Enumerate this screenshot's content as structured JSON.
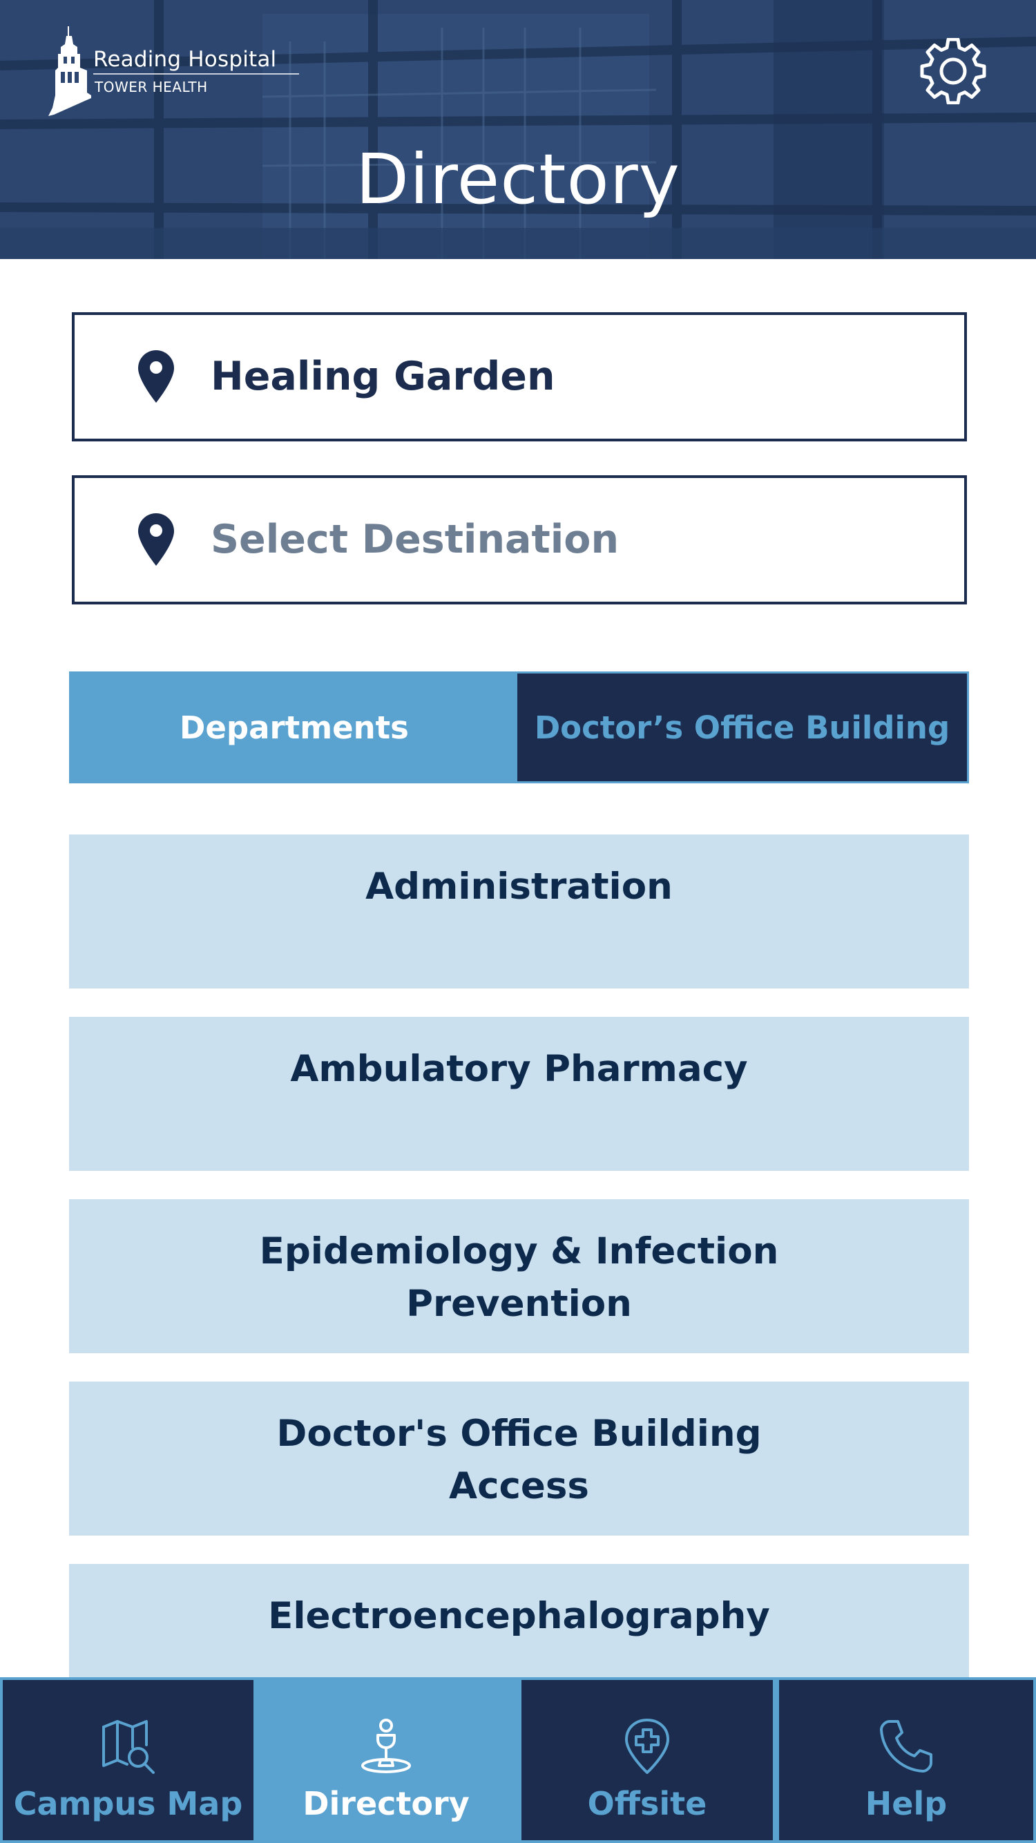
{
  "header": {
    "logo": {
      "name": "Reading Hospital",
      "subtitle": "TOWER HEALTH"
    },
    "title": "Directory",
    "settings_icon": "gear-icon"
  },
  "route": {
    "from": {
      "value": "Healing Garden",
      "icon": "map-pin-icon"
    },
    "to": {
      "placeholder": "Select Destination",
      "icon": "map-pin-icon"
    }
  },
  "tabs": [
    {
      "label": "Departments",
      "active": true
    },
    {
      "label": "Doctor’s Office Building",
      "active": false
    }
  ],
  "departments": [
    {
      "label": "Administration"
    },
    {
      "label": "Ambulatory Pharmacy"
    },
    {
      "label": "Epidemiology & Infection Prevention"
    },
    {
      "label": "Doctor's Office Building Access"
    },
    {
      "label": "Electroencephalography"
    }
  ],
  "bottom_nav": [
    {
      "label": "Campus Map",
      "icon": "map-search-icon",
      "active": false
    },
    {
      "label": "Directory",
      "icon": "directory-kiosk-icon",
      "active": true
    },
    {
      "label": "Offsite",
      "icon": "medical-pin-icon",
      "active": false
    },
    {
      "label": "Help",
      "icon": "phone-icon",
      "active": false
    }
  ],
  "colors": {
    "navy": "#1b2c4e",
    "accent_blue": "#5aa2d0",
    "list_bg": "#cae0ef",
    "list_text": "#0d2a4d",
    "placeholder_gray": "#6f7f93"
  }
}
